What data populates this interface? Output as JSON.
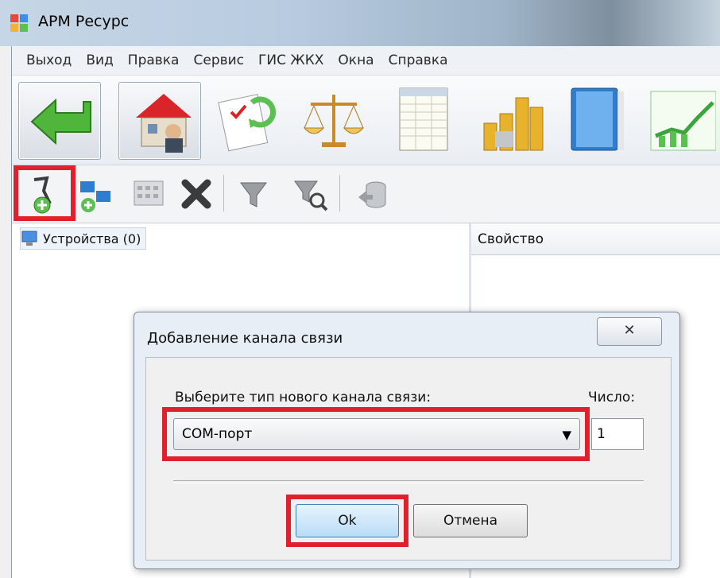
{
  "window": {
    "title": "АРМ Ресурс"
  },
  "menubar": {
    "items": [
      "Выход",
      "Вид",
      "Правка",
      "Сервис",
      "ГИС ЖКХ",
      "Окна",
      "Справка"
    ]
  },
  "toolbar_main": {
    "icons": [
      "back-arrow-icon",
      "house-icon",
      "documents-icon",
      "scales-icon",
      "spreadsheet-icon",
      "coins-icon",
      "book-icon",
      "chart-icon"
    ]
  },
  "toolbar_secondary": {
    "icons": [
      "add-channel-icon",
      "add-device-icon",
      "calculator-icon",
      "delete-icon",
      "filter-icon",
      "filter-search-icon",
      "database-icon"
    ]
  },
  "tree": {
    "root_label": "Устройства (0)"
  },
  "properties": {
    "header": "Свойство"
  },
  "dialog": {
    "title": "Добавление канала связи",
    "close_symbol": "✕",
    "type_label": "Выберите тип нового канала связи:",
    "type_value": "COM-порт",
    "count_label": "Число:",
    "count_value": "1",
    "ok_label": "Ok",
    "cancel_label": "Отмена"
  },
  "colors": {
    "highlight": "#e0202c",
    "ok_button": "#b8dcf6"
  }
}
